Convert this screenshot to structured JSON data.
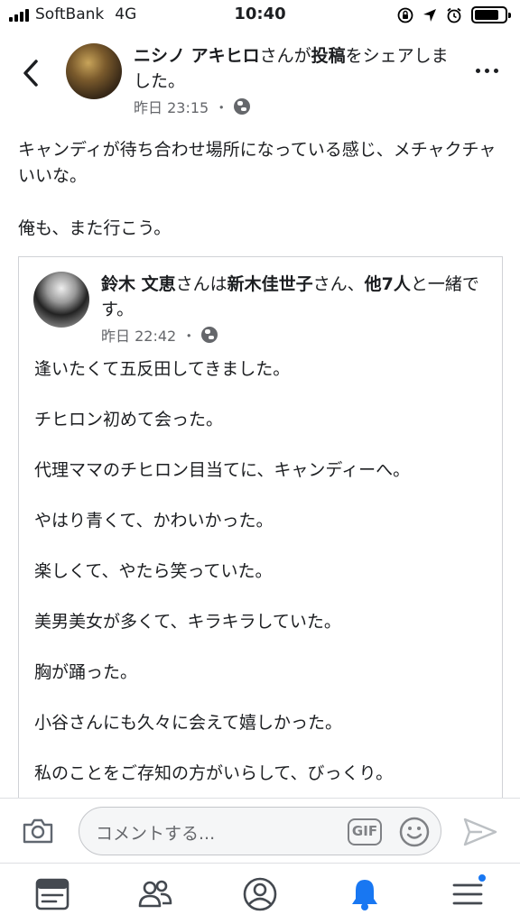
{
  "status_bar": {
    "carrier": "SoftBank",
    "network": "4G",
    "time": "10:40"
  },
  "header": {
    "author": "ニシノ アキヒロ",
    "action_prefix": "さんが",
    "action_strong": "投稿",
    "action_suffix": "をシェアしました。",
    "timestamp": "昨日 23:15",
    "dot": "・"
  },
  "post": {
    "paragraphs": [
      "キャンディが待ち合わせ場所になっている感じ、メチャクチャいいな。",
      "俺も、また行こう。"
    ]
  },
  "shared": {
    "author": "鈴木 文恵",
    "with_prefix": "さんは",
    "tagged": "新木佳世子",
    "with_mid": "さん、",
    "others": "他7人",
    "with_suffix": "と一緒です。",
    "timestamp": "昨日 22:42",
    "dot": "・",
    "lines": [
      "逢いたくて五反田してきました。",
      "チヒロン初めて会った。",
      "代理ママのチヒロン目当てに、キャンディーへ。",
      "やはり青くて、かわいかった。",
      "楽しくて、やたら笑っていた。",
      "美男美女が多くて、キラキラしていた。",
      "胸が踊った。",
      "小谷さんにも久々に会えて嬉しかった。",
      "私のことをご存知の方がいらして、びっくり。"
    ]
  },
  "comment_bar": {
    "placeholder": "コメントする...",
    "gif_label": "GIF"
  },
  "tabs": {
    "active": "notifications",
    "icons": [
      "news-feed-icon",
      "friends-icon",
      "profile-icon",
      "notifications-icon",
      "menu-icon"
    ]
  },
  "colors": {
    "accent": "#1877f2",
    "muted": "#65676b"
  }
}
